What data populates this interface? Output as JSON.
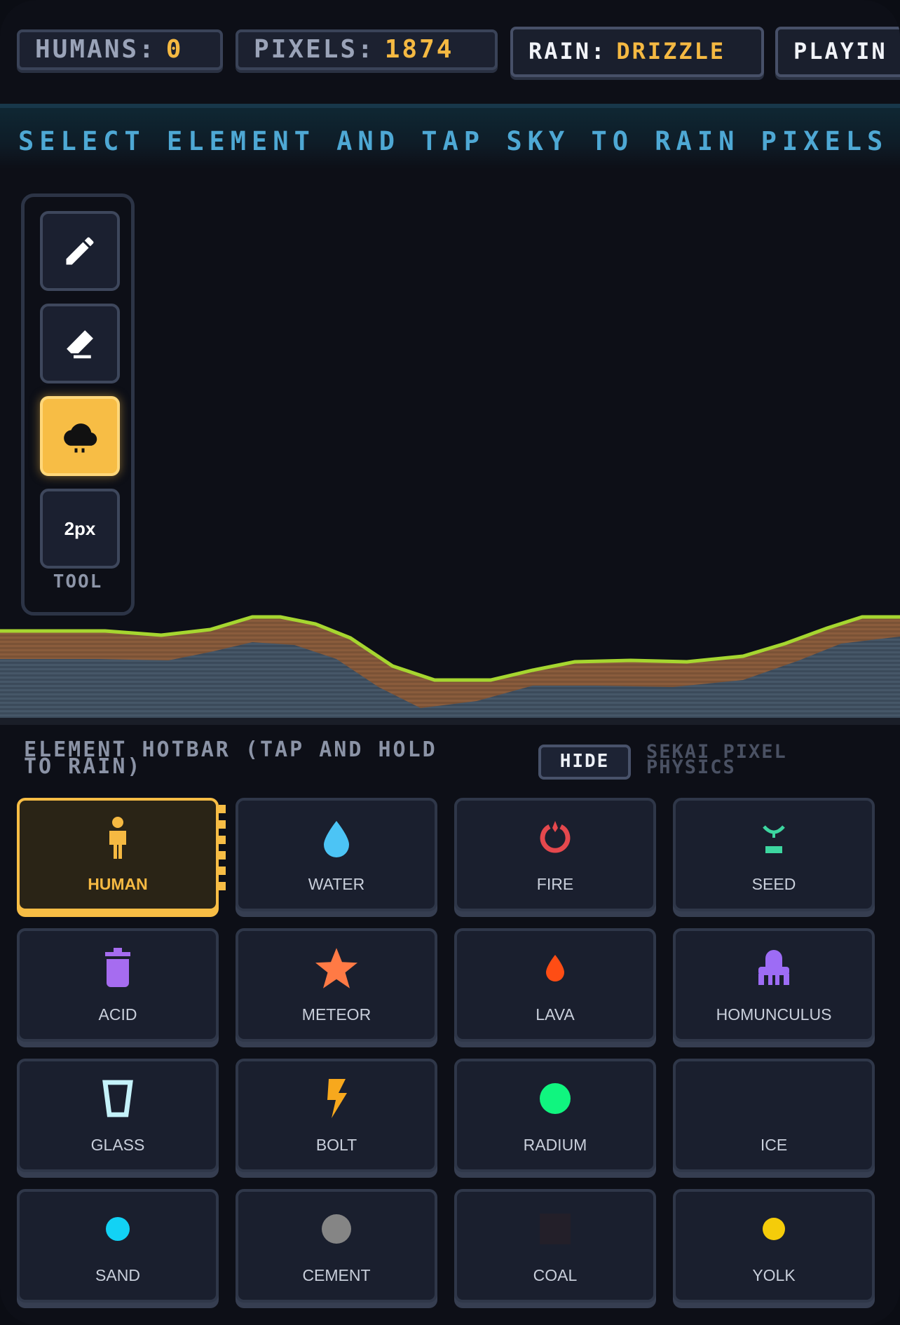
{
  "stats": {
    "humans_label": "HUMANS:",
    "humans_value": "0",
    "pixels_label": "PIXELS:",
    "pixels_value": "1874",
    "rain_label": "RAIN:",
    "rain_value": "DRIZZLE",
    "mode_label": "PLAYIN"
  },
  "banner": "SELECT ELEMENT AND TAP SKY TO RAIN PIXELS",
  "toolbar": {
    "tools": [
      {
        "name": "pencil-icon",
        "active": false
      },
      {
        "name": "eraser-icon",
        "active": false
      },
      {
        "name": "rain-cloud-icon",
        "active": true
      },
      {
        "name": "brush-size",
        "label": "2px",
        "active": false
      }
    ],
    "label": "TOOL"
  },
  "hotbar": {
    "title_line1": "ELEMENT HOTBAR (TAP AND HOLD",
    "title_line2": "TO RAIN)",
    "hide_label": "HIDE",
    "brand_line1": "SEKAI PIXEL",
    "brand_line2": "PHYSICS",
    "elements": [
      {
        "label": "HUMAN",
        "icon": "person-icon",
        "color": "#f5b942",
        "selected": true
      },
      {
        "label": "WATER",
        "icon": "water-drop-icon",
        "color": "#4cc4f5"
      },
      {
        "label": "FIRE",
        "icon": "fire-icon",
        "color": "#e5484d"
      },
      {
        "label": "SEED",
        "icon": "sprout-icon",
        "color": "#3dd6a0"
      },
      {
        "label": "ACID",
        "icon": "trash-can-icon",
        "color": "#a66cf0"
      },
      {
        "label": "METEOR",
        "icon": "star-icon",
        "color": "#ff7a45"
      },
      {
        "label": "LAVA",
        "icon": "lava-drop-icon",
        "color": "#ff4d14"
      },
      {
        "label": "HOMUNCULUS",
        "icon": "creature-icon",
        "color": "#9d6cf5"
      },
      {
        "label": "GLASS",
        "icon": "glass-cup-icon",
        "color": "#c5f2fa"
      },
      {
        "label": "BOLT",
        "icon": "lightning-icon",
        "color": "#f7a81d"
      },
      {
        "label": "RADIUM",
        "icon": "green-dot-icon",
        "color": "#10f57f"
      },
      {
        "label": "ICE",
        "icon": "none",
        "color": "#1a1f2e"
      },
      {
        "label": "SAND",
        "icon": "cyan-dot-icon",
        "color": "#12d2f5"
      },
      {
        "label": "CEMENT",
        "icon": "gray-dot-icon",
        "color": "#858585"
      },
      {
        "label": "COAL",
        "icon": "coal-square-icon",
        "color": "#231f29"
      },
      {
        "label": "YOLK",
        "icon": "yellow-dot-icon",
        "color": "#f5cc0a"
      }
    ]
  }
}
